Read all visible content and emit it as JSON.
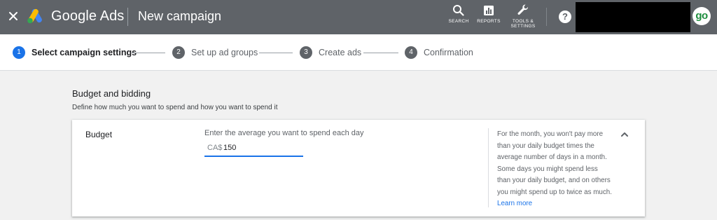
{
  "header": {
    "brand": "Google Ads",
    "page_title": "New campaign",
    "tools": {
      "search": "SEARCH",
      "reports": "REPORTS",
      "tools_line1": "TOOLS &",
      "tools_line2": "SETTINGS"
    },
    "help_glyph": "?",
    "avatar_text": "go"
  },
  "stepper": {
    "steps": [
      {
        "num": "1",
        "label": "Select campaign settings",
        "active": true
      },
      {
        "num": "2",
        "label": "Set up ad groups",
        "active": false
      },
      {
        "num": "3",
        "label": "Create ads",
        "active": false
      },
      {
        "num": "4",
        "label": "Confirmation",
        "active": false
      }
    ]
  },
  "section": {
    "title": "Budget and bidding",
    "subtitle": "Define how much you want to spend and how you want to spend it"
  },
  "budget": {
    "label": "Budget",
    "prompt": "Enter the average you want to spend each day",
    "currency": "CA$",
    "value": "150",
    "help_text": "For the month, you won't pay more than your daily budget times the average number of days in a month. Some days you might spend less than your daily budget, and on others you might spend up to twice as much.",
    "learn_more": "Learn more"
  },
  "colors": {
    "topbar": "#5f6368",
    "accent": "#1a73e8",
    "background": "#f1f1f1"
  }
}
